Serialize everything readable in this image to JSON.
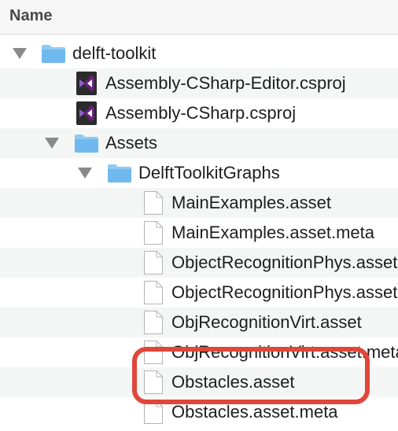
{
  "header": {
    "column_name": "Name"
  },
  "rows": [
    {
      "label": "delft-toolkit",
      "type": "folder",
      "expanded": true
    },
    {
      "label": "Assembly-CSharp-Editor.csproj",
      "type": "csproj"
    },
    {
      "label": "Assembly-CSharp.csproj",
      "type": "csproj"
    },
    {
      "label": "Assets",
      "type": "folder",
      "expanded": true
    },
    {
      "label": "DelftToolkitGraphs",
      "type": "folder",
      "expanded": true
    },
    {
      "label": "MainExamples.asset",
      "type": "file"
    },
    {
      "label": "MainExamples.asset.meta",
      "type": "file"
    },
    {
      "label": "ObjectRecognitionPhys.asset",
      "type": "file"
    },
    {
      "label": "ObjectRecognitionPhys.asset.meta",
      "type": "file"
    },
    {
      "label": "ObjRecognitionVirt.asset",
      "type": "file"
    },
    {
      "label": "ObjRecognitionVirt.asset.meta",
      "type": "file"
    },
    {
      "label": "Obstacles.asset",
      "type": "file",
      "highlighted": true
    },
    {
      "label": "Obstacles.asset.meta",
      "type": "file"
    }
  ],
  "colors": {
    "folder": "#6fb9ee",
    "visual_studio": "#68217a",
    "highlight": "#e0463a",
    "alt_row": "#f4f5f5"
  }
}
